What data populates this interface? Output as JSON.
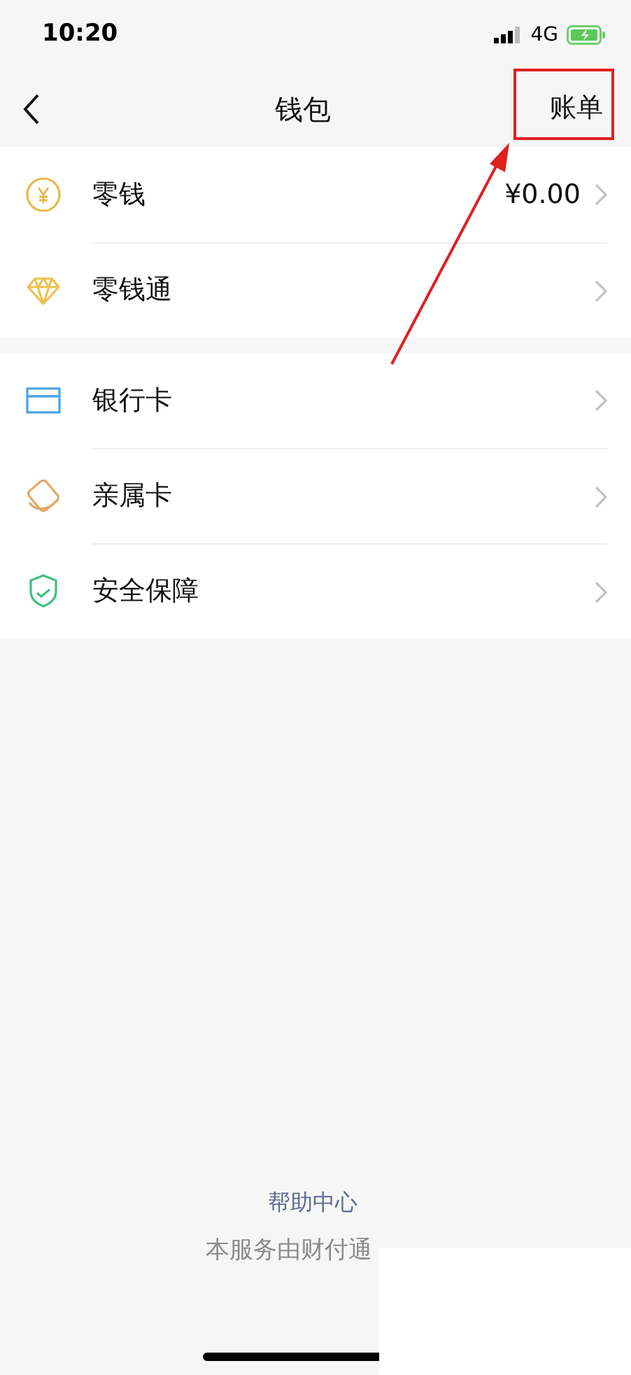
{
  "status_bar": {
    "time": "10:20",
    "network": "4G"
  },
  "nav": {
    "title": "钱包",
    "action": "账单"
  },
  "groups": [
    {
      "items": [
        {
          "kind": "coin",
          "label": "零钱",
          "value": "¥0.00"
        },
        {
          "kind": "diamond",
          "label": "零钱通"
        }
      ]
    },
    {
      "items": [
        {
          "kind": "card",
          "label": "银行卡"
        },
        {
          "kind": "family",
          "label": "亲属卡"
        },
        {
          "kind": "shield",
          "label": "安全保障"
        }
      ]
    }
  ],
  "footer": {
    "link": "帮助中心",
    "note": "本服务由财付通"
  },
  "annotation": {
    "kind": "highlight-arrow"
  }
}
